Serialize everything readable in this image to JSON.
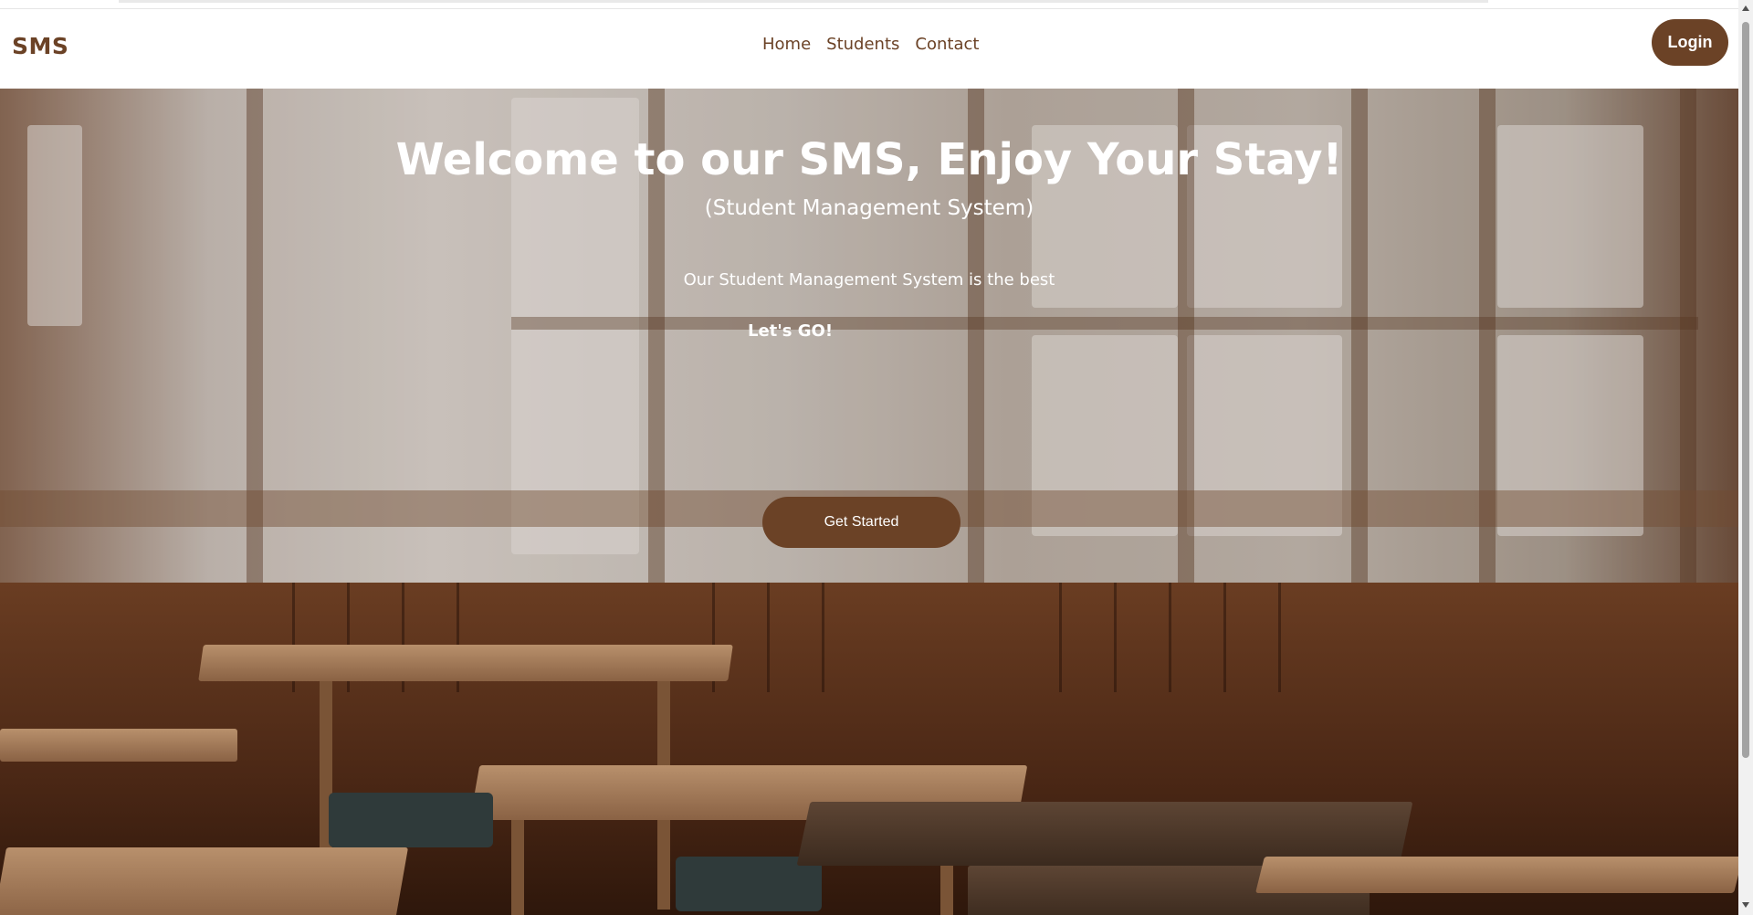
{
  "navbar": {
    "brand": "SMS",
    "links": [
      "Home",
      "Students",
      "Contact"
    ],
    "login_label": "Login"
  },
  "hero": {
    "title": "Welcome to our SMS, Enjoy Your Stay!",
    "subtitle": "(Student Management System)",
    "description": "Our Student Management System is the best",
    "tagline": "Let's GO!",
    "cta_label": "Get Started"
  },
  "colors": {
    "brand": "#6b4226",
    "text_on_hero": "#ffffff",
    "navbar_bg": "#ffffff"
  }
}
